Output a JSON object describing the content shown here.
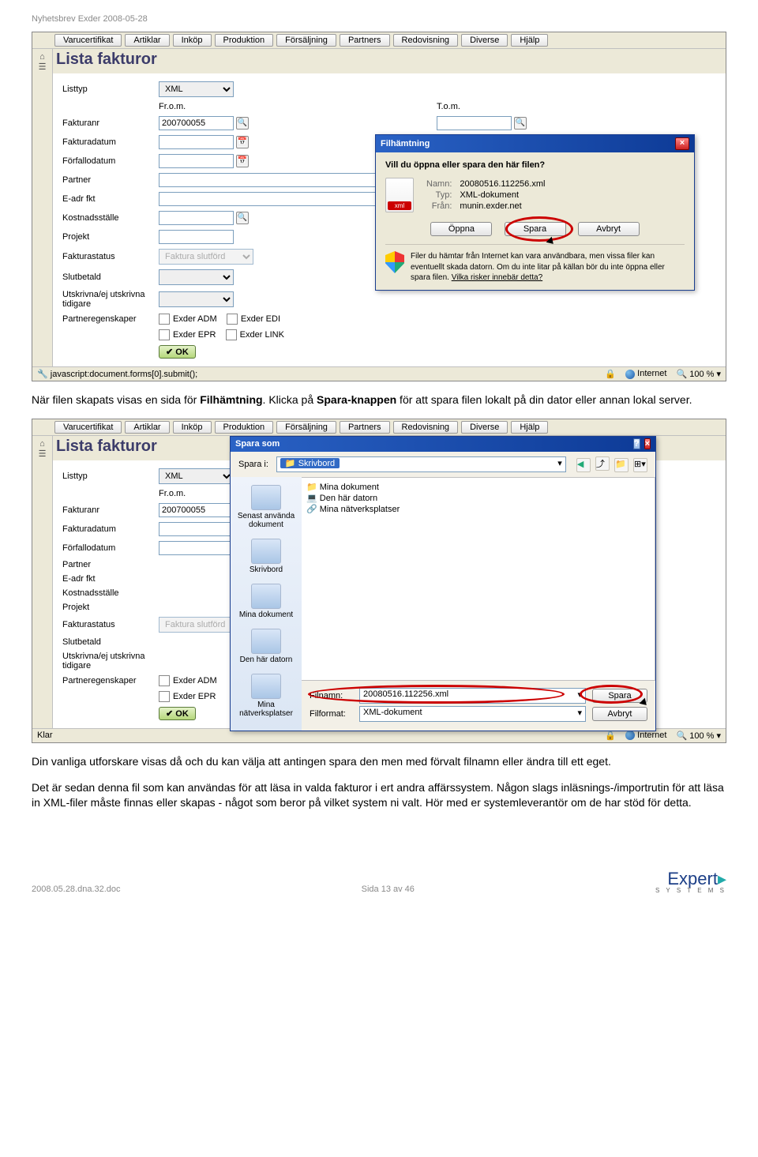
{
  "doc_header": "Nyhetsbrev Exder 2008-05-28",
  "menu": [
    "Varucertifikat",
    "Artiklar",
    "Inköp",
    "Produktion",
    "Försäljning",
    "Partners",
    "Redovisning",
    "Diverse",
    "Hjälp"
  ],
  "list_title": "Lista fakturor",
  "form": {
    "listtyp": {
      "label": "Listtyp",
      "value": "XML"
    },
    "from": "Fr.o.m.",
    "tom": "T.o.m.",
    "fakturanr": {
      "label": "Fakturanr",
      "value": "200700055"
    },
    "fakturadatum": "Fakturadatum",
    "forfallodatum": "Förfallodatum",
    "partner": "Partner",
    "eadr": "E-adr fkt",
    "kostnadsstalle": "Kostnadsställe",
    "projekt": "Projekt",
    "fakturastatus": {
      "label": "Fakturastatus",
      "value": "Faktura slutförd"
    },
    "slutbetald": "Slutbetald",
    "utskrivna": "Utskrivna/ej utskrivna tidigare",
    "partneregenskaper": "Partneregenskaper",
    "chk": [
      "Exder ADM",
      "Exder EDI",
      "Exder EPR",
      "Exder LINK"
    ],
    "ok": "✔ OK"
  },
  "statusbar1": {
    "left": "javascript:document.forms[0].submit();",
    "net": "Internet",
    "zoom": "100 %"
  },
  "statusbar2": {
    "left": "Klar",
    "net": "Internet",
    "zoom": "100 %"
  },
  "dl_dialog": {
    "title": "Filhämtning",
    "question": "Vill du öppna eller spara den här filen?",
    "name_k": "Namn:",
    "name_v": "20080516.112256.xml",
    "type_k": "Typ:",
    "type_v": "XML-dokument",
    "from_k": "Från:",
    "from_v": "munin.exder.net",
    "open": "Öppna",
    "save": "Spara",
    "cancel": "Avbryt",
    "warn": "Filer du hämtar från Internet kan vara användbara, men vissa filer kan eventuellt skada datorn. Om du inte litar på källan bör du inte öppna eller spara filen.",
    "risk": "Vilka risker innebär detta?"
  },
  "save_dialog": {
    "title": "Spara som",
    "save_in": "Spara i:",
    "location": "Skrivbord",
    "places": [
      "Senast använda dokument",
      "Skrivbord",
      "Mina dokument",
      "Den här datorn",
      "Mina nätverksplatser"
    ],
    "items": [
      {
        "t": "Mina dokument",
        "c": "f"
      },
      {
        "t": "Den här datorn",
        "c": "comp"
      },
      {
        "t": "Mina nätverksplatser",
        "c": "net"
      }
    ],
    "fn_label": "Filnamn:",
    "fn_value": "20080516.112256.xml",
    "ft_label": "Filformat:",
    "ft_value": "XML-dokument",
    "save": "Spara",
    "cancel": "Avbryt"
  },
  "para1_a": "När filen skapats visas en sida för ",
  "para1_b": "Filhämtning",
  "para1_c": ". Klicka på ",
  "para1_d": "Spara-knappen",
  "para1_e": " för att spara filen lokalt på din dator eller annan lokal server.",
  "para2": "Din vanliga utforskare visas då och du kan välja att antingen spara den men med förvalt filnamn eller ändra till ett eget.",
  "para3": "Det är sedan denna fil som kan användas för att läsa in valda fakturor i ert andra affärssystem. Någon slags inläsnings-/importrutin för att läsa in XML-filer måste finnas eller skapas - något som beror på vilket system ni valt. Hör med er systemleverantör om de har stöd för detta.",
  "footer": {
    "left": "2008.05.28.dna.32.doc",
    "center": "Sida 13 av 46"
  },
  "logo": {
    "name": "Expert",
    "sub": "S Y S T E M S"
  }
}
